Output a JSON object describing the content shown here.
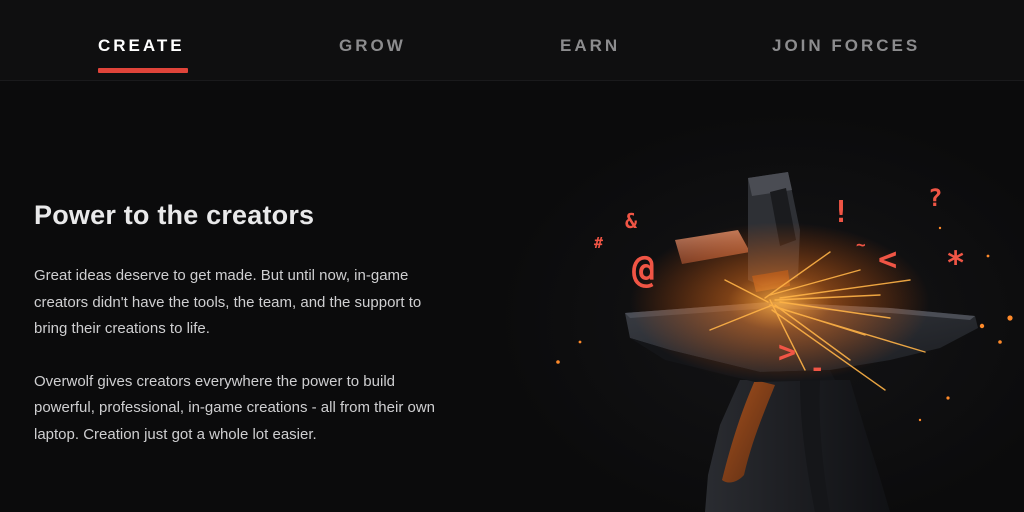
{
  "tabs": [
    {
      "label": "CREATE",
      "active": true
    },
    {
      "label": "GROW",
      "active": false
    },
    {
      "label": "EARN",
      "active": false
    },
    {
      "label": "JOIN FORCES",
      "active": false
    }
  ],
  "main": {
    "title": "Power to the creators",
    "paragraphs": [
      "Great ideas deserve to get made. But until now, in-game creators didn't have the tools, the team, and the support to bring their creations to life.",
      "Overwolf gives creators everywhere the power to build powerful, professional, in-game creations - all from their own laptop. Creation just got a whole lot easier."
    ]
  },
  "illustration": {
    "name": "anvil-hammer-sparks-illustration",
    "symbols": [
      "&",
      "#",
      "@",
      "!",
      "?",
      "<",
      "*",
      ">",
      "~",
      "-"
    ]
  },
  "colors": {
    "accent": "#e0443a",
    "background": "#0b0b0c",
    "tab_inactive": "#8c8c8e",
    "spark": "#ff8a2a"
  }
}
